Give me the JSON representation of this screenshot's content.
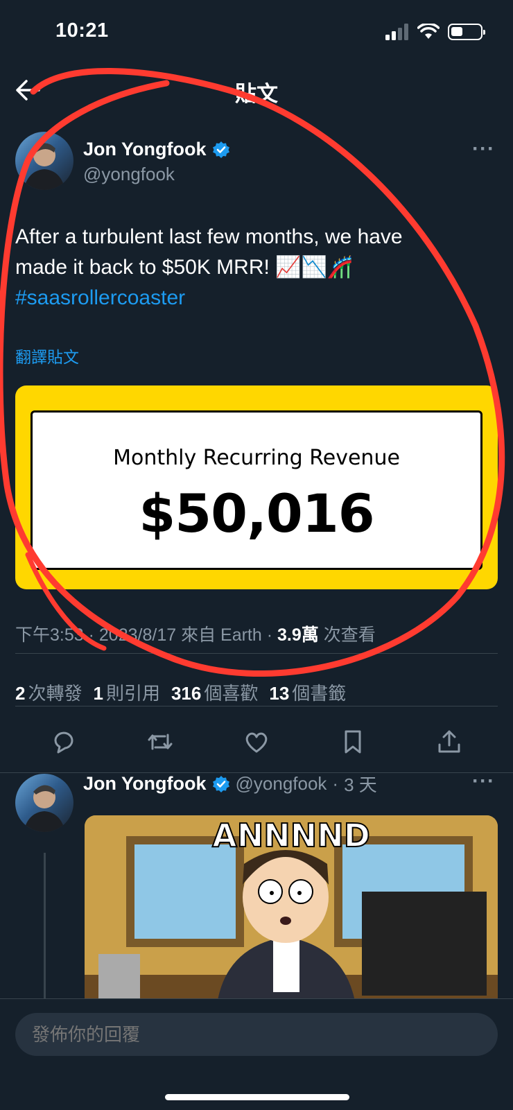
{
  "status_bar": {
    "time": "10:21"
  },
  "header": {
    "title": "貼文"
  },
  "tweet": {
    "author_name": "Jon Yongfook",
    "handle": "@yongfook",
    "text_line1": "After a turbulent last few months, we have",
    "text_line2": "made it back to $50K MRR! 📈📉🎢",
    "hashtag": "#saasrollercoaster",
    "translate": "翻譯貼文",
    "media": {
      "label": "Monthly Recurring Revenue",
      "value": "$50,016"
    },
    "meta": {
      "time": "下午3:53",
      "date": "2023/8/17",
      "source": "來自 Earth",
      "views": "3.9萬",
      "views_label": "次查看"
    },
    "stats": {
      "retweets": "2",
      "retweets_label": "次轉發",
      "quotes": "1",
      "quotes_label": "則引用",
      "likes": "316",
      "likes_label": "個喜歡",
      "bookmarks": "13",
      "bookmarks_label": "個書籤"
    }
  },
  "reply": {
    "author_name": "Jon Yongfook",
    "handle": "@yongfook",
    "age": "3 天",
    "gif_caption": "ANNNND"
  },
  "composer": {
    "placeholder": "發佈你的回覆"
  },
  "colors": {
    "accent": "#1d9bf0",
    "background": "#15202b",
    "annotation": "#ff3b30",
    "card_yellow": "#ffd700"
  }
}
